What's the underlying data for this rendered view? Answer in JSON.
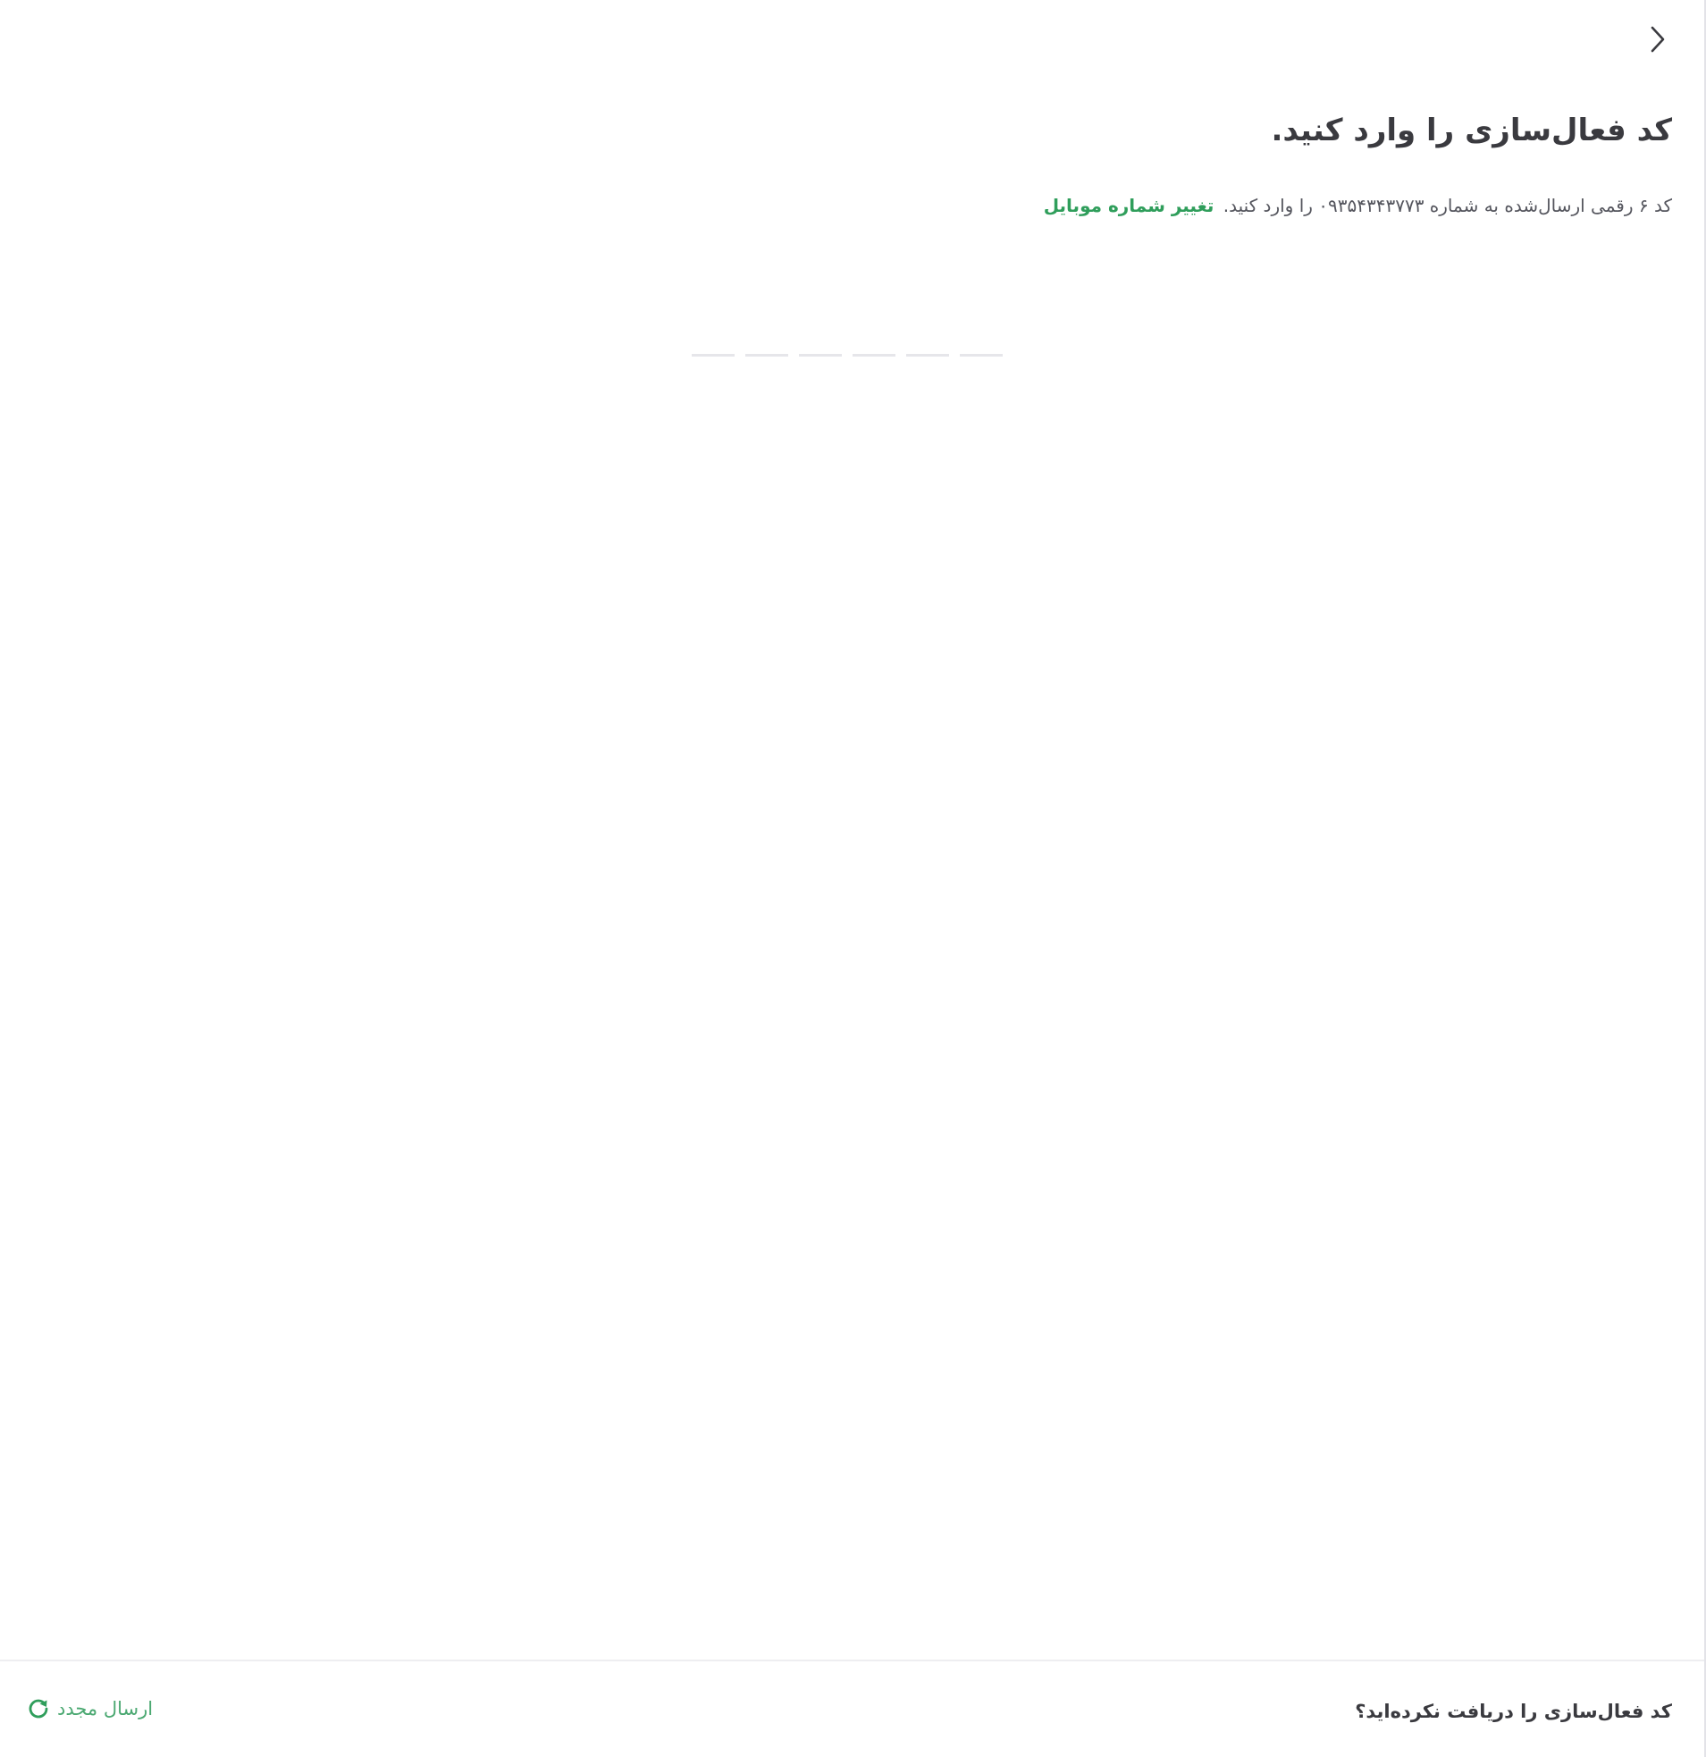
{
  "header": {
    "back_icon": "chevron-right-icon"
  },
  "main": {
    "title": "کد فعال‌سازی را وارد کنید.",
    "instruction": "کد ۶ رقمی ارسال‌شده به شماره ۰۹۳۵۴۳۴۳۷۷۳ را وارد کنید.",
    "change_number_link": "تغییر شماره موبایل",
    "otp_length": 6
  },
  "footer": {
    "question": "کد فعال‌سازی را دریافت نکرده‌اید؟",
    "resend_label": "ارسال مجدد",
    "resend_icon": "refresh-icon"
  },
  "colors": {
    "accent": "#2f9e5b",
    "text": "#3a3a3f",
    "otp_underline": "#e6e6ea"
  }
}
